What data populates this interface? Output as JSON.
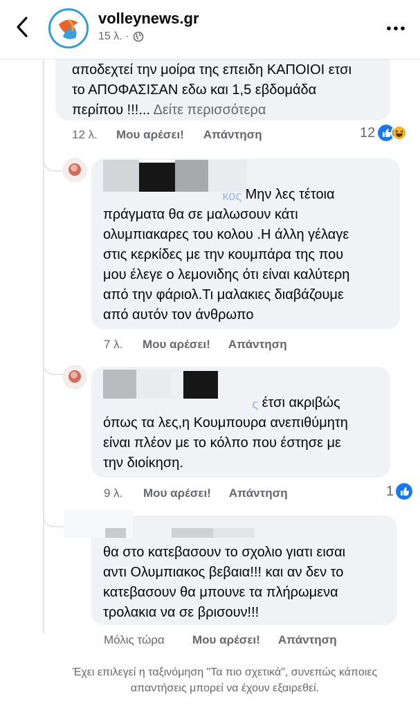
{
  "header": {
    "page_name": "volleynews.gr",
    "post_time": "15 λ. ·",
    "back_icon": "chevron-left-icon",
    "globe_icon": "globe-icon",
    "more_icon": "more-dots-icon"
  },
  "comments": [
    {
      "text": "αποδεχτεί την μοίρα της επειδη ΚΑΠΟΙΟΙ ετσι\nτο ΑΠΟΦΑΣΙΣΑΝ εδω και 1,5 εβδομάδα\nπερίπου !!!...",
      "see_more": "Δείτε περισσότερα",
      "time": "12 λ.",
      "like": "Μου αρέσει!",
      "reply": "Απάντηση",
      "reaction_count": "12"
    },
    {
      "name_suffix": "κος",
      "text_first": "Μην λες τέτοια",
      "text": "πράγματα  θα σε μαλωσουν κάτι\nολυμπιακαρες του κολου .Η άλλη γέλαγε\nστις κερκίδες με την κουμπάρα της που\nμου έλεγε ο λεμονιδης ότι είναι καλύτερη\nαπό την φάριολ.Τι μαλακιες διαβάζουμε\nαπό αυτόν τον άνθρωπο",
      "time": "7 λ.",
      "like": "Μου αρέσει!",
      "reply": "Απάντηση"
    },
    {
      "name_suffix": "ς",
      "text_first": "έτσι ακριβώς",
      "text": "όπως τα λες,η Κουμπουρα ανεπιθύμητη\nείναι πλέον με το κόλπο που έστησε με\nτην διοίκηση.",
      "time": "9 λ.",
      "like": "Μου αρέσει!",
      "reply": "Απάντηση",
      "reaction_count": "1"
    },
    {
      "text": "θα στο κατεβασουν το σχολιο γιατι εισαι\nαντι Ολυμπιακος βεβαια!!! και αν δεν το\nκατεβασουν θα μπουνε τα πλήρωμενα\nτρολακια να σε βρισουν!!!",
      "time": "Μόλις τώρα",
      "like": "Μου αρέσει!",
      "reply": "Απάντηση"
    }
  ],
  "notice": "Έχει επιλεγεί η ταξινόμηση \"Τα πιο σχετικά\", συνεπώς κάποιες απαντήσεις μπορεί να έχουν εξαιρεθεί.",
  "colors": {
    "bubble": "#f0f2f5",
    "link_blue": "#1877f2",
    "secondary": "#65676b",
    "haha_yellow": "#f7b125"
  }
}
